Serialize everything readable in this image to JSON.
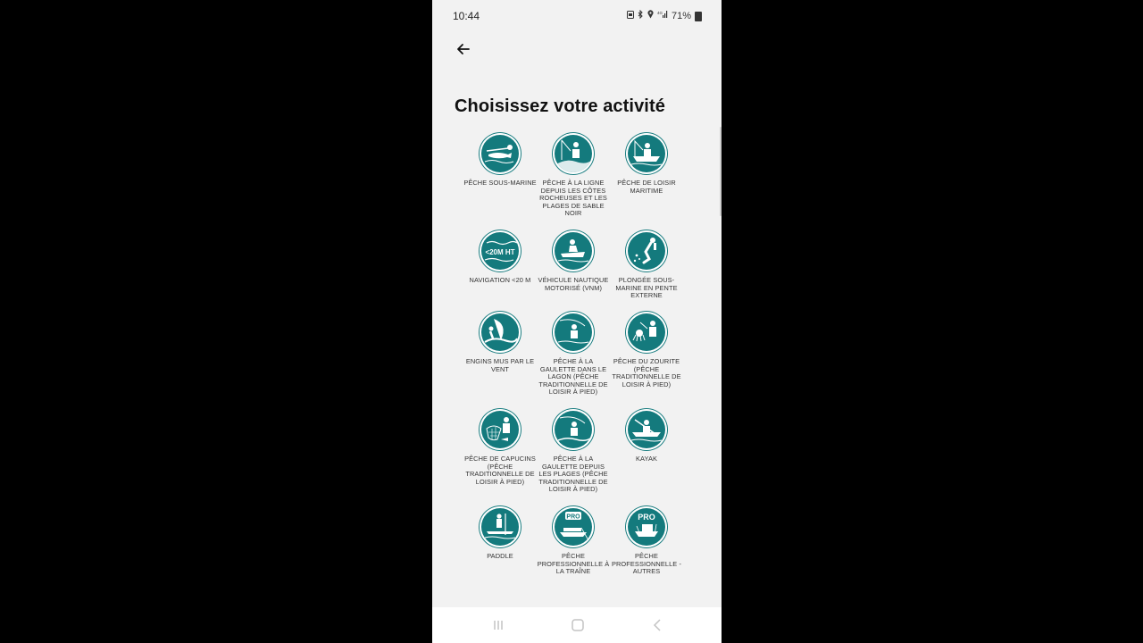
{
  "status_bar": {
    "time": "10:44",
    "battery_percent": "71%"
  },
  "page": {
    "title": "Choisissez votre activité"
  },
  "accent_color": "#147a7d",
  "activities": [
    {
      "label": "PÊCHE SOUS-MARINE",
      "icon": "spearfishing-icon"
    },
    {
      "label": "PÊCHE À LA LIGNE DEPUIS LES CÔTES ROCHEUSES ET LES PLAGES DE SABLE NOIR",
      "icon": "line-fishing-icon"
    },
    {
      "label": "PÊCHE DE LOISIR MARITIME",
      "icon": "boat-fishing-icon"
    },
    {
      "label": "NAVIGATION <20 M",
      "icon": "navigation-icon",
      "icon_text": "<20M HT"
    },
    {
      "label": "VÉHICULE NAUTIQUE MOTORISÉ (VNM)",
      "icon": "jet-ski-icon"
    },
    {
      "label": "PLONGÉE SOUS-MARINE EN PENTE EXTERNE",
      "icon": "scuba-diving-icon"
    },
    {
      "label": "ENGINS MUS PAR LE VENT",
      "icon": "windsurf-icon"
    },
    {
      "label": "PÊCHE À LA GAULETTE DANS LE LAGON (PÊCHE TRADITIONNELLE DE LOISIR À PIED)",
      "icon": "rod-lagoon-icon"
    },
    {
      "label": "PÊCHE DU ZOURITE (PÊCHE TRADITIONNELLE DE LOISIR À PIED)",
      "icon": "octopus-fishing-icon"
    },
    {
      "label": "PÊCHE DE CAPUCINS (PÊCHE TRADITIONNELLE DE LOISIR À PIED)",
      "icon": "net-fishing-icon"
    },
    {
      "label": "PÊCHE À LA GAULETTE DEPUIS LES PLAGES (PÊCHE TRADITIONNELLE DE LOISIR À PIED)",
      "icon": "rod-beach-icon"
    },
    {
      "label": "KAYAK",
      "icon": "kayak-icon"
    },
    {
      "label": "PADDLE",
      "icon": "paddle-icon"
    },
    {
      "label": "PÊCHE PROFESSIONNELLE À LA TRAÎNE",
      "icon": "pro-trolling-icon",
      "icon_text": "PRO"
    },
    {
      "label": "PÊCHE PROFESSIONNELLE - AUTRES",
      "icon": "pro-other-icon",
      "icon_text": "PRO"
    }
  ]
}
